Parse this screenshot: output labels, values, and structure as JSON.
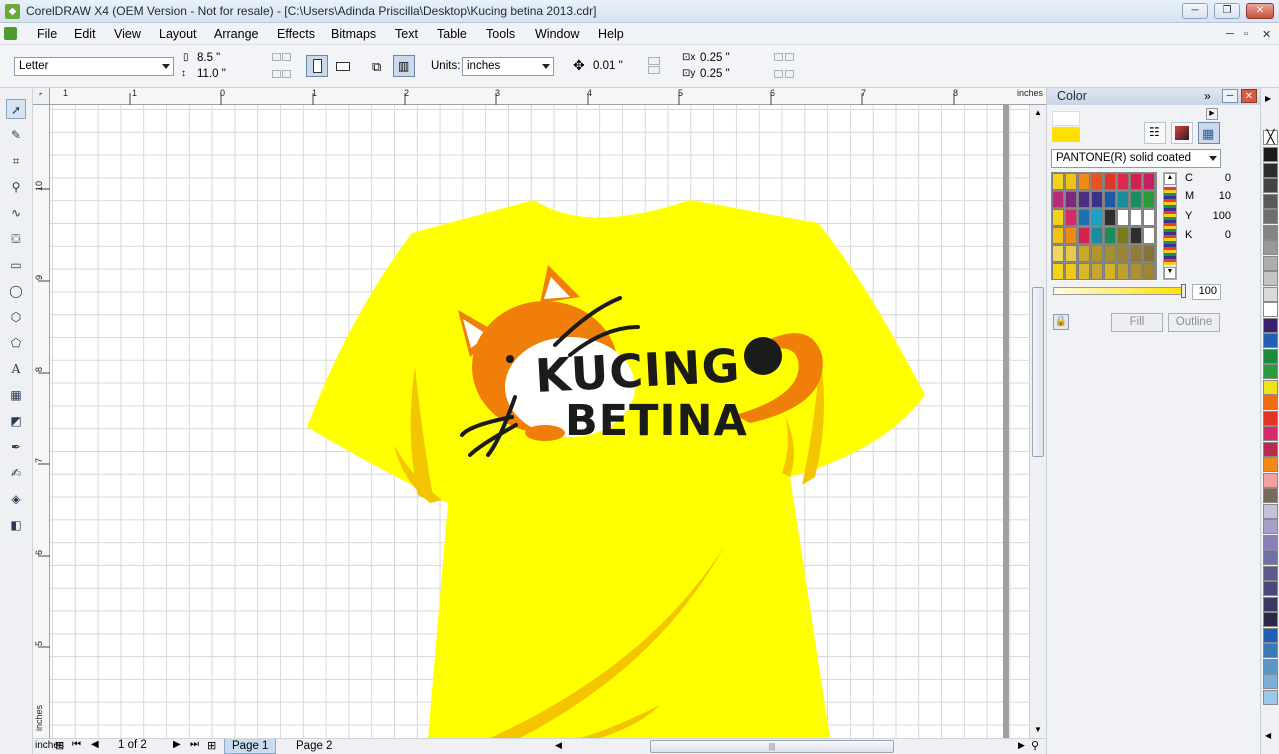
{
  "window": {
    "title": "CorelDRAW X4 (OEM Version - Not for resale) - [C:\\Users\\Adinda Priscilla\\Desktop\\Kucing betina 2013.cdr]",
    "min_label": "─",
    "max_label": "❐",
    "close_label": "✕"
  },
  "menu": {
    "items": [
      "File",
      "Edit",
      "View",
      "Layout",
      "Arrange",
      "Effects",
      "Bitmaps",
      "Text",
      "Table",
      "Tools",
      "Window",
      "Help"
    ],
    "mdi_min": "─",
    "mdi_restore": "▫",
    "mdi_close": "✕"
  },
  "propbar": {
    "page_size": "Letter",
    "width": "8.5 \"",
    "height": "11.0 \"",
    "units_label": "Units:",
    "units_value": "inches",
    "nudge": "0.01 \"",
    "dup_x": "0.25 \"",
    "dup_y": "0.25 \""
  },
  "rulers": {
    "unit": "inches",
    "h_ticks": [
      "1",
      "0",
      "1",
      "2",
      "3",
      "4",
      "5",
      "6",
      "7",
      "8"
    ],
    "v_ticks": [
      "10",
      "9",
      "8",
      "7",
      "6",
      "5"
    ],
    "v_unit": "inches"
  },
  "artwork": {
    "line1": "KUCING",
    "line2": "BETINA",
    "shirt_color": "#ffff00",
    "accent_color": "#f5c400",
    "cat_color": "#f07f0a"
  },
  "status": {
    "page_count": "1 of 2",
    "pages": [
      "Page 1",
      "Page 2"
    ]
  },
  "docker": {
    "title": "Color",
    "palette_name": "PANTONE(R) solid coated",
    "c_label": "C",
    "c_value": "0",
    "m_label": "M",
    "m_value": "10",
    "y_label": "Y",
    "y_value": "100",
    "k_label": "K",
    "k_value": "0",
    "tint_value": "100",
    "fill_label": "Fill",
    "outline_label": "Outline",
    "swatch_rows": [
      [
        "#f4d21a",
        "#f2c315",
        "#ef8b12",
        "#e9531f",
        "#e23526",
        "#dd2a4a",
        "#d6224e",
        "#c71f66"
      ],
      [
        "#b72b7c",
        "#7a2a7f",
        "#4a2f86",
        "#3a3389",
        "#1f5aa6",
        "#1a8d9c",
        "#1a8c5e",
        "#2a9c3c"
      ],
      [
        "#f4d21a",
        "#d82a6a",
        "#1f6fb4",
        "#19a1c8",
        "#2e2e2e",
        "#ffffff",
        "#ffffff",
        "#ffffff"
      ],
      [
        "#f2c315",
        "#ef8b12",
        "#d6224e",
        "#1a8d9c",
        "#1a8c5e",
        "#7c7b1c",
        "#2e2e2e",
        "#ffffff"
      ],
      [
        "#efd65c",
        "#e8c84a",
        "#c9a82a",
        "#b2962c",
        "#a58f33",
        "#9a8636",
        "#8f7c38",
        "#84743a"
      ],
      [
        "#f5d31a",
        "#f1c91a",
        "#d9b62a",
        "#c5a62e",
        "#d4b322",
        "#bfa02c",
        "#ad922f",
        "#9f8731"
      ]
    ],
    "palette_strip": [
      "#1a1a1a",
      "#2d2d2d",
      "#444444",
      "#595959",
      "#6e6e6e",
      "#838383",
      "#999999",
      "#aeaeae",
      "#c4c4c4",
      "#dadada",
      "#ffffff",
      "#3c1f6e",
      "#1f5fb4",
      "#1a8d3c",
      "#2a9c3c",
      "#f2e21a",
      "#ef6c12",
      "#e23526",
      "#d82a6a",
      "#b72b4c",
      "#f28a1a",
      "#f4a0a0",
      "#7a6a5a",
      "#c8c0d8",
      "#a8a0c8",
      "#8880b8",
      "#7070a8",
      "#5e5a90",
      "#4a4878",
      "#3a3a60",
      "#2a2a48",
      "#1f5fb4",
      "#3a7ab8",
      "#5a96c8",
      "#7ab0d8",
      "#9ac8e8"
    ]
  }
}
